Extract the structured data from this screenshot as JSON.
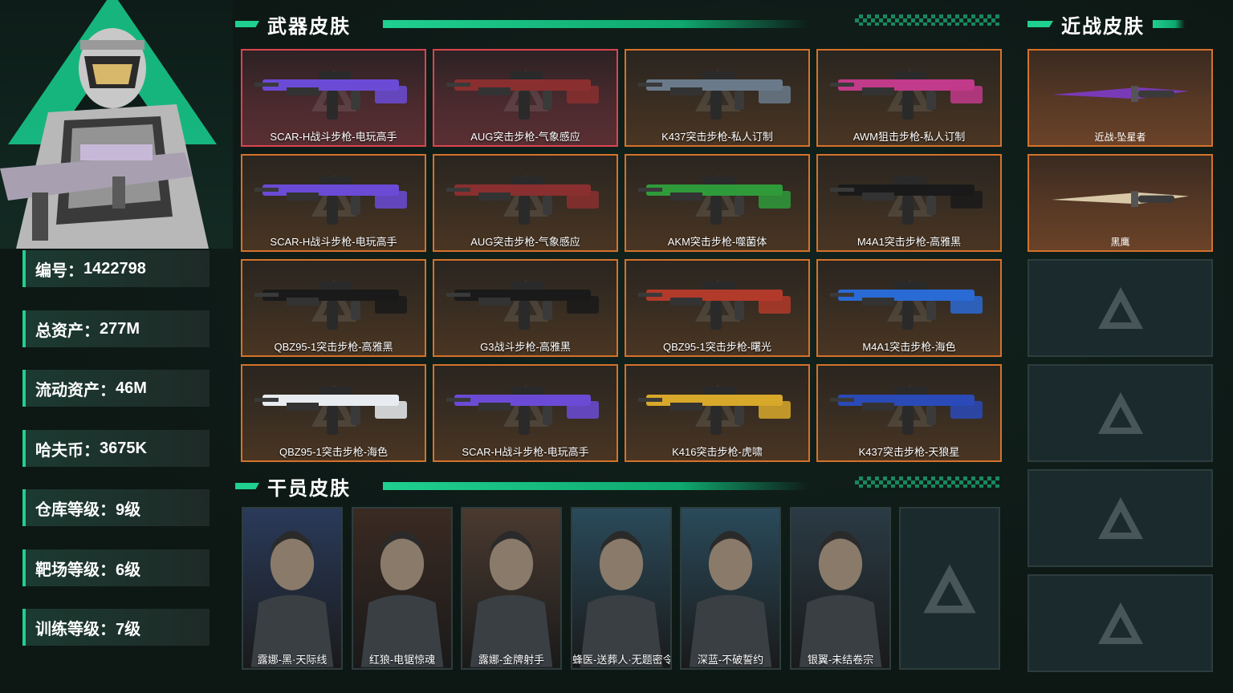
{
  "player": {
    "stats": [
      {
        "label": "编号：",
        "value": "1422798"
      },
      {
        "label": "总资产：",
        "value": "277M"
      },
      {
        "label": "流动资产：",
        "value": "46M"
      },
      {
        "label": "哈夫币：",
        "value": "3675K"
      },
      {
        "label": "仓库等级：",
        "value": "9级"
      },
      {
        "label": "靶场等级：",
        "value": "6级"
      },
      {
        "label": "训练等级：",
        "value": "7级"
      }
    ]
  },
  "sections": {
    "weapons_title": "武器皮肤",
    "melee_title": "近战皮肤",
    "operators_title": "干员皮肤"
  },
  "weapons": [
    {
      "name": "SCAR-H战斗步枪-电玩高手",
      "rarity": "red",
      "color": "#6b4bd6"
    },
    {
      "name": "AUG突击步枪-气象感应",
      "rarity": "red",
      "color": "#8a2f2f"
    },
    {
      "name": "K437突击步枪-私人订制",
      "rarity": "orange",
      "color": "#6a7a8a"
    },
    {
      "name": "AWM狙击步枪-私人订制",
      "rarity": "orange",
      "color": "#c23a8a"
    },
    {
      "name": "SCAR-H战斗步枪-电玩高手",
      "rarity": "orange",
      "color": "#6b4bd6"
    },
    {
      "name": "AUG突击步枪-气象感应",
      "rarity": "orange",
      "color": "#8a2f2f"
    },
    {
      "name": "AKM突击步枪-噬菌体",
      "rarity": "orange",
      "color": "#2f9a3a"
    },
    {
      "name": "M4A1突击步枪-高雅黑",
      "rarity": "orange",
      "color": "#1a1a1a"
    },
    {
      "name": "QBZ95-1突击步枪-高雅黑",
      "rarity": "orange",
      "color": "#1a1a1a"
    },
    {
      "name": "G3战斗步枪-高雅黑",
      "rarity": "orange",
      "color": "#1a1a1a"
    },
    {
      "name": "QBZ95-1突击步枪-曙光",
      "rarity": "orange",
      "color": "#b23a2a"
    },
    {
      "name": "M4A1突击步枪-海色",
      "rarity": "orange",
      "color": "#2a6ad4"
    },
    {
      "name": "QBZ95-1突击步枪-海色",
      "rarity": "orange",
      "color": "#e8ecf0"
    },
    {
      "name": "SCAR-H战斗步枪-电玩高手",
      "rarity": "orange",
      "color": "#6b4bd6"
    },
    {
      "name": "K416突击步枪-虎啸",
      "rarity": "orange",
      "color": "#d8a82a"
    },
    {
      "name": "K437突击步枪-天狼星",
      "rarity": "orange",
      "color": "#2a4ab8"
    }
  ],
  "melee": [
    {
      "name": "近战-坠星者",
      "color": "#7a3ab8"
    },
    {
      "name": "黑鹰",
      "color": "#d8c8a8"
    },
    {
      "name": ""
    },
    {
      "name": ""
    },
    {
      "name": ""
    },
    {
      "name": ""
    }
  ],
  "operators": [
    {
      "name": "露娜-黑·天际线",
      "bg": "#2a3a5a"
    },
    {
      "name": "红狼-电锯惊魂",
      "bg": "#3a2a22"
    },
    {
      "name": "露娜-金牌射手",
      "bg": "#4a3a30"
    },
    {
      "name": "蜂医-送葬人·无题密令",
      "bg": "#2a4a5a"
    },
    {
      "name": "深蓝-不破誓约",
      "bg": "#2a4a5a"
    },
    {
      "name": "银翼-未结卷宗",
      "bg": "#2a3a44"
    },
    {
      "name": ""
    }
  ]
}
